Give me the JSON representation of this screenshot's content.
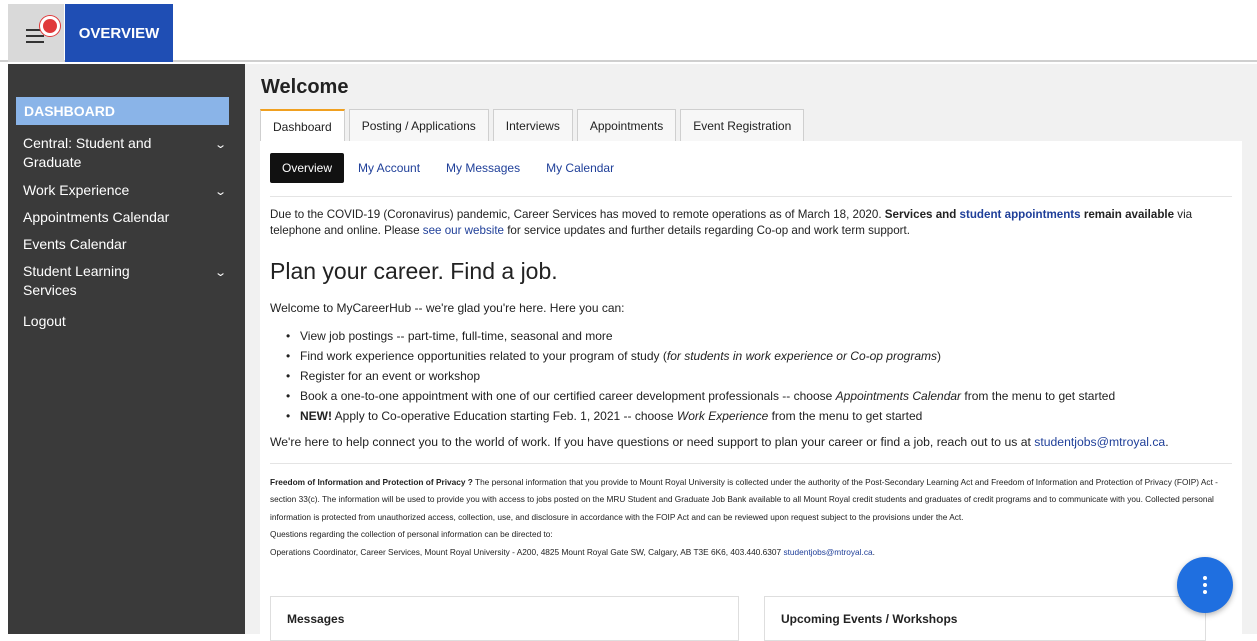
{
  "topbar": {
    "overview_label": "OVERVIEW"
  },
  "sidebar": {
    "dashboard_label": "DASHBOARD",
    "items": [
      {
        "label": "Central: Student and Graduate",
        "has_submenu": true
      },
      {
        "label": "Work Experience",
        "has_submenu": true
      },
      {
        "label": "Appointments Calendar",
        "has_submenu": false
      },
      {
        "label": "Events Calendar",
        "has_submenu": false
      },
      {
        "label": "Student Learning Services",
        "has_submenu": true
      },
      {
        "label": "Logout",
        "has_submenu": false
      }
    ],
    "chevron": "⌄"
  },
  "main": {
    "title": "Welcome",
    "tabs": [
      {
        "label": "Dashboard",
        "active": true
      },
      {
        "label": "Posting / Applications",
        "active": false
      },
      {
        "label": "Interviews",
        "active": false
      },
      {
        "label": "Appointments",
        "active": false
      },
      {
        "label": "Event Registration",
        "active": false
      }
    ],
    "subtabs": [
      {
        "label": "Overview",
        "active": true
      },
      {
        "label": "My Account",
        "active": false
      },
      {
        "label": "My Messages",
        "active": false
      },
      {
        "label": "My Calendar",
        "active": false
      }
    ],
    "covid": {
      "part1": "Due to the COVID-19 (Coronavirus) pandemic, Career Services has moved to remote operations as of March 18, 2020. ",
      "bold1": "Services and ",
      "link1": "student appointments",
      "bold2": " remain available",
      "part2": " via telephone and online. Please ",
      "link2": "see our website",
      "part3": " for service updates and further details regarding Co-op and work term support."
    },
    "headline": "Plan your career. Find a job.",
    "intro": "Welcome to MyCareerHub -- we're glad you're here. Here you can:",
    "bullets": {
      "b1": "View job postings -- part-time, full-time, seasonal and more",
      "b2_text": "Find work experience opportunities related to your program of study (",
      "b2_em": "for students in work experience or Co-op programs",
      "b2_end": ")",
      "b3": "Register for an event or workshop",
      "b4_text": "Book a one-to-one appointment with one of our certified career development professionals -- choose ",
      "b4_em": "Appointments Calendar",
      "b4_end": " from the menu to get started",
      "b5_new": "NEW!",
      "b5_text": " Apply to Co-operative Education starting Feb. 1, 2021 -- choose ",
      "b5_em": "Work Experience",
      "b5_end": " from the menu to get started"
    },
    "help_text": "We're here to help connect you to the world of work. If you have questions or need support to plan your career or find a job, reach out to us at ",
    "help_email": "studentjobs@mtroyal.ca",
    "help_end": ".",
    "foip": {
      "title": "Freedom of Information and Protection of Privacy ?",
      "body": " The personal information that you provide to Mount Royal University is collected under the authority of the Post-Secondary Learning Act and Freedom of Information and Protection of Privacy (FOIP) Act - section 33(c). The information will be used to provide you with access to jobs posted on the MRU Student and Graduate Job Bank available to all Mount Royal credit students and graduates of credit programs and to communicate with you. Collected personal information is protected from unauthorized access, collection, use, and disclosure in accordance with the FOIP Act and can be reviewed upon request subject to the provisions under the Act.",
      "questions": "Questions regarding the collection of personal information can be directed to:",
      "contact": "Operations Coordinator, Career Services, Mount Royal University - A200, 4825 Mount Royal Gate SW, Calgary, AB  T3E 6K6, 403.440.6307 ",
      "contact_email": "studentjobs@mtroyal.ca",
      "contact_end": "."
    },
    "cards": {
      "messages_title": "Messages",
      "events_title": "Upcoming Events / Workshops"
    }
  },
  "colors": {
    "overview_tab": "#1f4eb4",
    "sidebar_bg": "#3a3a3a",
    "dashboard_highlight": "#8ab4e8",
    "link": "#1f3f99",
    "active_tab_accent": "#f0a020",
    "fab": "#1f6fe0",
    "notification_dot": "#e0393a"
  },
  "icons": {
    "menu": "hamburger-menu-icon",
    "notification": "notification-dot-icon",
    "fab": "more-vertical-icon"
  }
}
